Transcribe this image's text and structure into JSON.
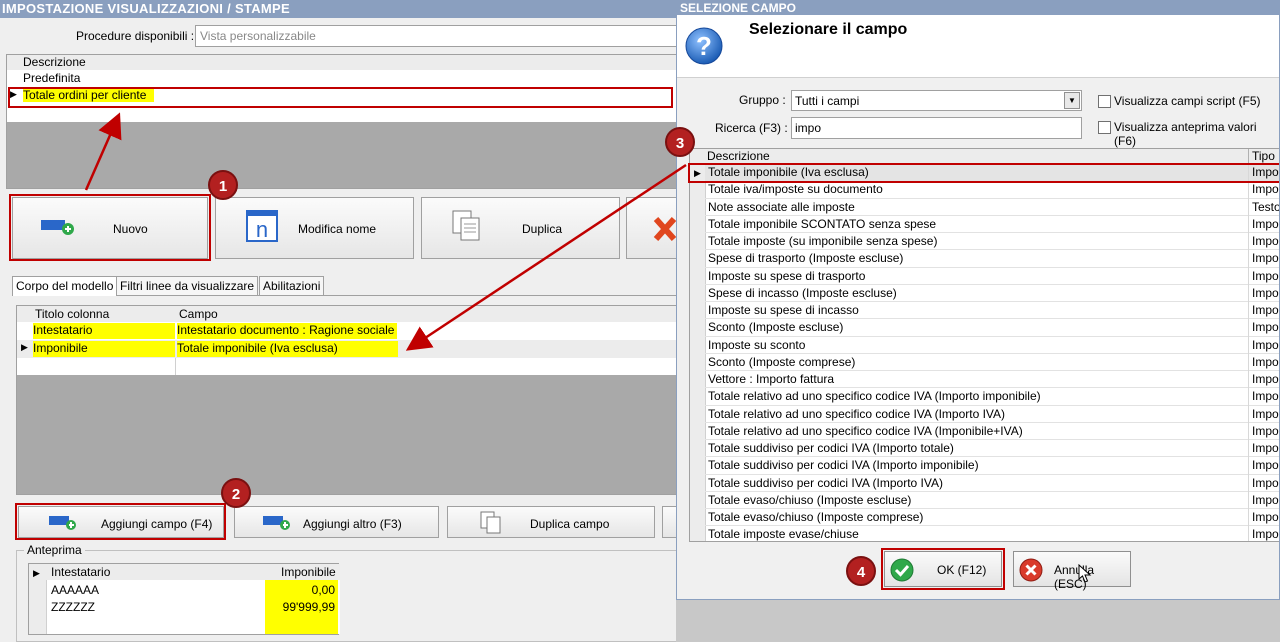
{
  "main": {
    "title": "IMPOSTAZIONE VISUALIZZAZIONI / STAMPE",
    "procedure_label": "Procedure disponibili :",
    "procedure_value": "Vista personalizzabile",
    "list_header": "Descrizione",
    "list_items": [
      "Predefinita",
      "Totale ordini per cliente"
    ],
    "buttons": {
      "nuovo": "Nuovo",
      "modifica_nome": "Modifica nome",
      "duplica": "Duplica"
    },
    "tabs": [
      "Corpo del modello",
      "Filtri linee da visualizzare",
      "Abilitazioni"
    ],
    "columns_grid": {
      "headers": [
        "Titolo colonna",
        "Campo"
      ],
      "rows": [
        {
          "titolo": "Intestatario",
          "campo": "Intestatario documento : Ragione sociale"
        },
        {
          "titolo": "Imponibile",
          "campo": "Totale imponibile (Iva esclusa)"
        }
      ]
    },
    "bottom_buttons": {
      "aggiungi_campo": "Aggiungi campo (F4)",
      "aggiungi_altro": "Aggiungi altro (F3)",
      "duplica_campo": "Duplica campo"
    },
    "preview": {
      "label": "Anteprima",
      "headers": [
        "Intestatario",
        "Imponibile"
      ],
      "rows": [
        {
          "intestatario": "AAAAAA",
          "imponibile": "0,00"
        },
        {
          "intestatario": "ZZZZZZ",
          "imponibile": "99'999,99"
        }
      ]
    }
  },
  "dialog": {
    "title": "SELEZIONE CAMPO",
    "heading": "Selezionare il campo",
    "gruppo_label": "Gruppo :",
    "gruppo_value": "Tutti i campi",
    "ricerca_label": "Ricerca (F3) :",
    "ricerca_value": "impo",
    "check_script": "Visualizza campi script (F5)",
    "check_anteprima": "Visualizza anteprima valori (F6)",
    "headers": [
      "Descrizione",
      "Tipo"
    ],
    "rows": [
      {
        "d": "Totale imponibile (Iva esclusa)",
        "t": "Impor"
      },
      {
        "d": "Totale iva/imposte su documento",
        "t": "Impor"
      },
      {
        "d": "Note associate alle imposte",
        "t": "Testo"
      },
      {
        "d": "Totale imponibile SCONTATO senza spese",
        "t": "Impor"
      },
      {
        "d": "Totale imposte (su imponibile senza spese)",
        "t": "Impor"
      },
      {
        "d": "Spese di trasporto (Imposte escluse)",
        "t": "Impor"
      },
      {
        "d": "Imposte su spese di trasporto",
        "t": "Impor"
      },
      {
        "d": "Spese di incasso (Imposte escluse)",
        "t": "Impor"
      },
      {
        "d": "Imposte su spese di incasso",
        "t": "Impor"
      },
      {
        "d": "Sconto (Imposte escluse)",
        "t": "Impor"
      },
      {
        "d": "Imposte su sconto",
        "t": "Impor"
      },
      {
        "d": "Sconto (Imposte comprese)",
        "t": "Impor"
      },
      {
        "d": "Vettore : Importo fattura",
        "t": "Impor"
      },
      {
        "d": "Totale relativo ad uno specifico codice IVA (Importo imponibile)",
        "t": "Impor"
      },
      {
        "d": "Totale relativo ad uno specifico codice IVA (Importo IVA)",
        "t": "Impor"
      },
      {
        "d": "Totale relativo ad uno specifico codice IVA (Imponibile+IVA)",
        "t": "Impor"
      },
      {
        "d": "Totale suddiviso per codici IVA (Importo totale)",
        "t": "Impor"
      },
      {
        "d": "Totale suddiviso per codici IVA (Importo imponibile)",
        "t": "Impor"
      },
      {
        "d": "Totale suddiviso per codici IVA (Importo IVA)",
        "t": "Impor"
      },
      {
        "d": "Totale evaso/chiuso (Imposte escluse)",
        "t": "Impor"
      },
      {
        "d": "Totale evaso/chiuso (Imposte comprese)",
        "t": "Impor"
      },
      {
        "d": "Totale imposte evase/chiuse",
        "t": "Impor"
      }
    ],
    "ok": "OK (F12)",
    "annulla": "Annulla (ESC)"
  },
  "badges": [
    "1",
    "2",
    "3",
    "4"
  ]
}
